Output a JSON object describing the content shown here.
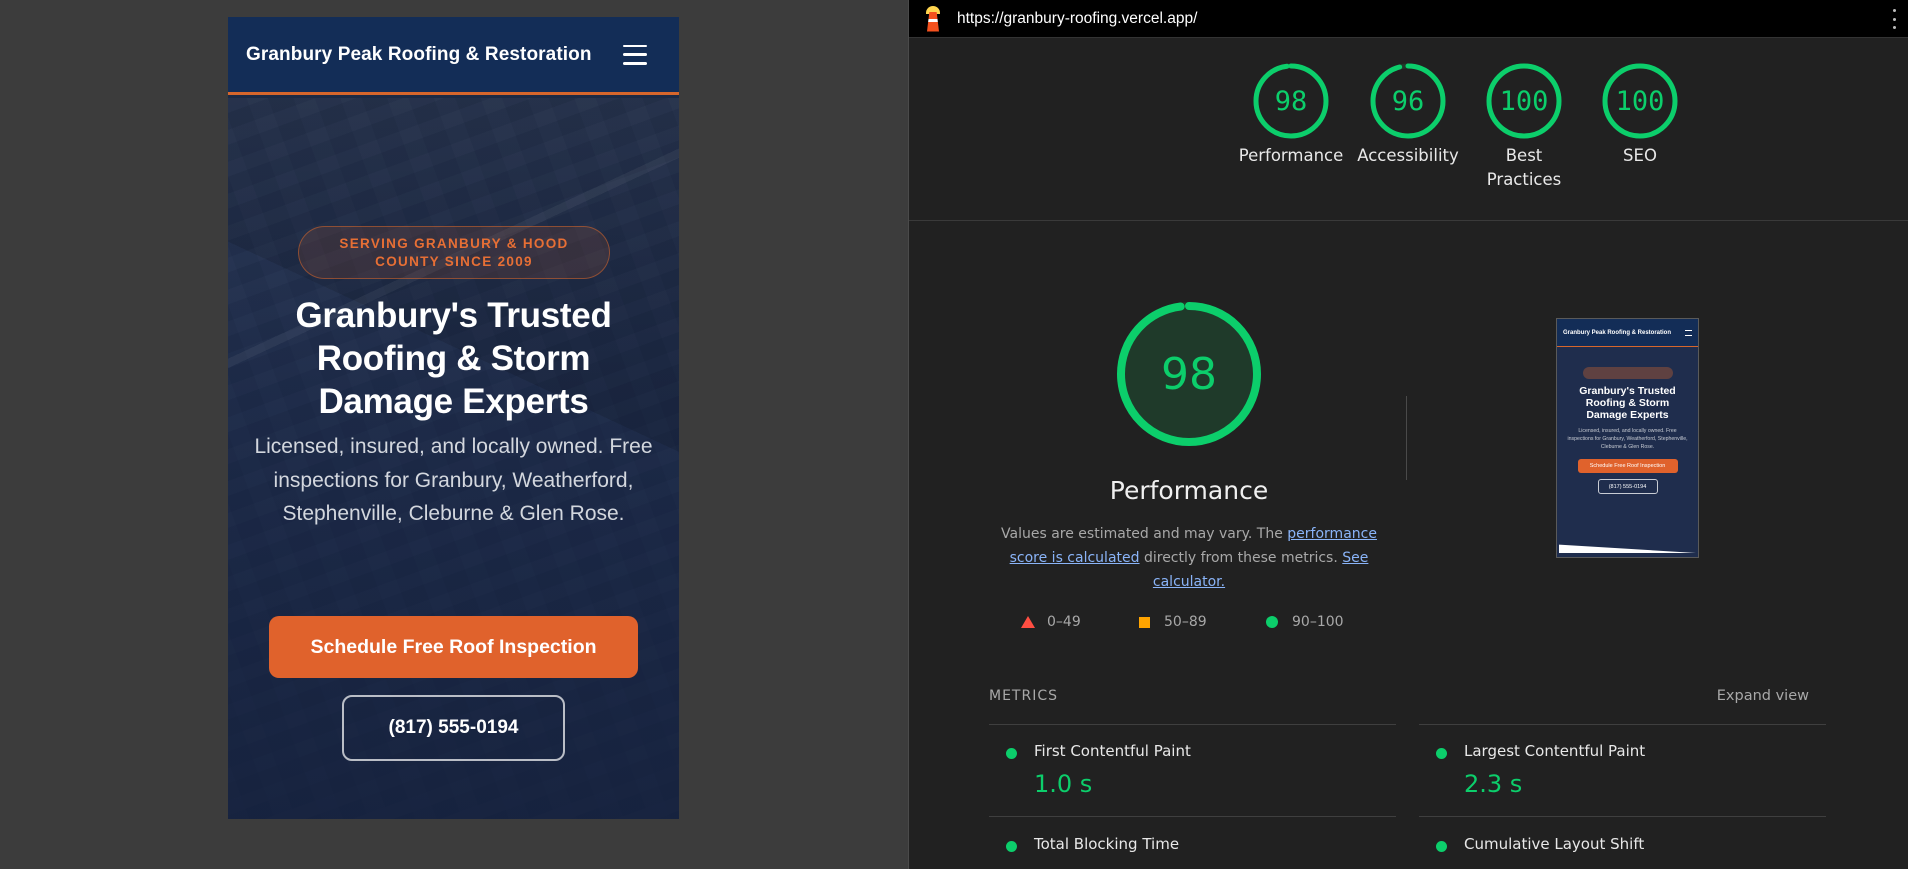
{
  "site": {
    "brand": "Granbury Peak Roofing & Restoration",
    "badge": "SERVING GRANBURY & HOOD COUNTY SINCE 2009",
    "headline": "Granbury's Trusted Roofing & Storm Damage Experts",
    "subtitle": "Licensed, insured, and locally owned. Free inspections for Granbury, Weatherford, Stephenville, Cleburne & Glen Rose.",
    "cta": "Schedule Free Roof Inspection",
    "phone": "(817) 555-0194"
  },
  "report": {
    "url": "https://granbury-roofing.vercel.app/",
    "categories": [
      {
        "label": "Performance",
        "score": 98
      },
      {
        "label": "Accessibility",
        "score": 96
      },
      {
        "label": "Best Practices",
        "score": 100
      },
      {
        "label": "SEO",
        "score": 100
      }
    ],
    "performance": {
      "title": "Performance",
      "score": 98,
      "note_prefix": "Values are estimated and may vary. The ",
      "note_link1": "performance score is calculated",
      "note_mid": " directly from these metrics. ",
      "note_link2": "See calculator."
    },
    "legend": [
      {
        "range": "0–49",
        "color": "#ff4e42"
      },
      {
        "range": "50–89",
        "color": "#ffa400"
      },
      {
        "range": "90–100",
        "color": "#0cce6b"
      }
    ],
    "metrics_heading": "METRICS",
    "expand_label": "Expand view",
    "metrics": [
      {
        "name": "First Contentful Paint",
        "value": "1.0 s"
      },
      {
        "name": "Largest Contentful Paint",
        "value": "2.3 s"
      },
      {
        "name": "Total Blocking Time",
        "value": ""
      },
      {
        "name": "Cumulative Layout Shift",
        "value": ""
      }
    ],
    "colors": {
      "pass": "#0cce6b",
      "average": "#ffa400",
      "fail": "#ff4e42"
    }
  },
  "icons": {
    "menu": "hamburger-menu-icon",
    "lighthouse": "lighthouse-logo-icon",
    "more": "kebab-menu-icon"
  }
}
